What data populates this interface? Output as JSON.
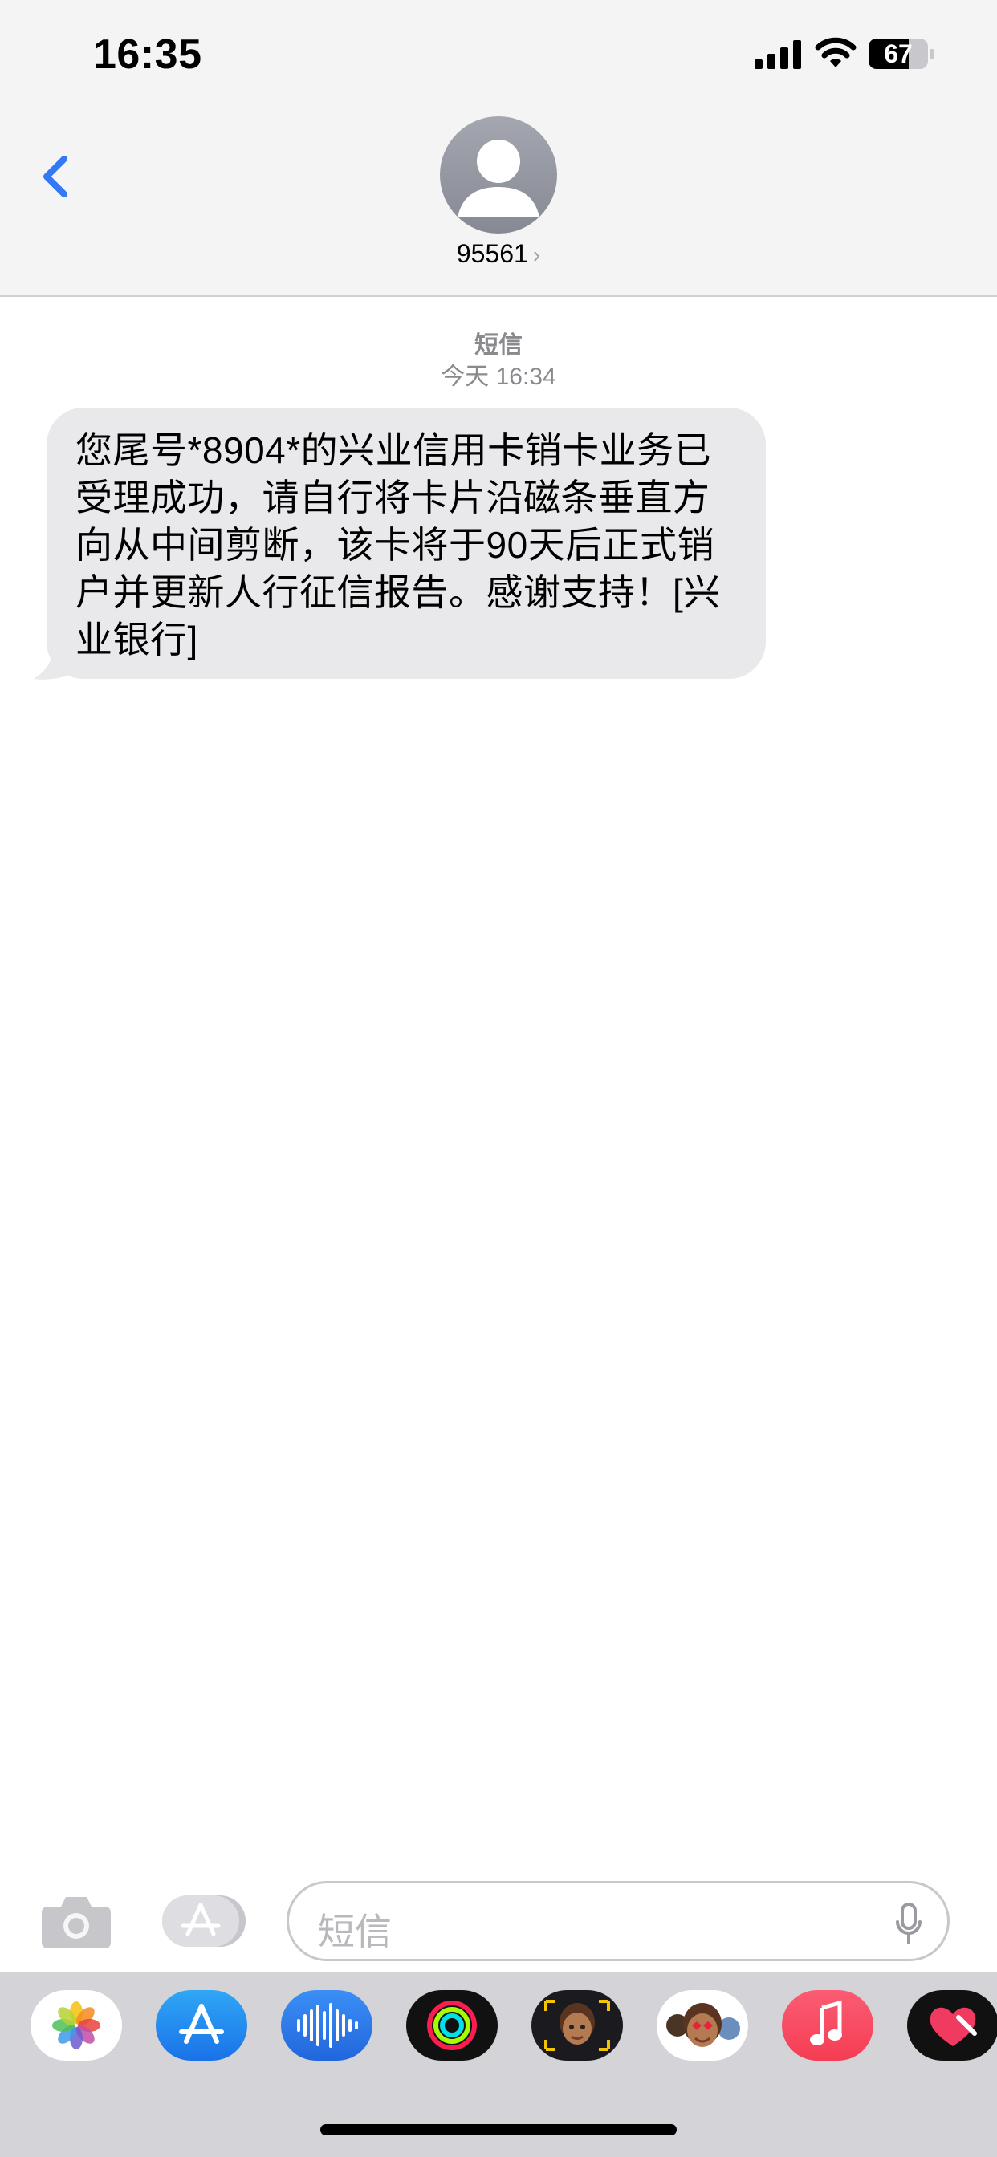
{
  "status_bar": {
    "time": "16:35",
    "battery_text": "67",
    "battery_level": 0.67
  },
  "header": {
    "back_icon": "chevron-left-icon",
    "contact_name": "95561",
    "contact_chevron": "›"
  },
  "conversation": {
    "message_type": "短信",
    "timestamp": "今天 16:34",
    "messages": [
      {
        "direction": "incoming",
        "text": "您尾号*8904*的兴业信用卡销卡业务已受理成功，请自行将卡片沿磁条垂直方向从中间剪断，该卡将于90天后正式销户并更新人行征信报告。感谢支持！[兴业银行]"
      }
    ]
  },
  "input_bar": {
    "placeholder": "短信",
    "camera_icon": "camera-icon",
    "appstore_icon": "app-store-icon",
    "mic_icon": "microphone-icon"
  },
  "app_drawer": {
    "apps": [
      {
        "name": "photos-app-icon"
      },
      {
        "name": "app-store-app-icon"
      },
      {
        "name": "audio-message-app-icon"
      },
      {
        "name": "fitness-app-icon"
      },
      {
        "name": "memoji-app-icon"
      },
      {
        "name": "memoji-stickers-app-icon"
      },
      {
        "name": "music-app-icon"
      },
      {
        "name": "digital-touch-app-icon"
      }
    ]
  },
  "colors": {
    "header_bg": "#f4f4f5",
    "accent_blue": "#3478f6",
    "bubble_gray": "#e9e9eb",
    "drawer_bg": "#d3d3d8"
  }
}
